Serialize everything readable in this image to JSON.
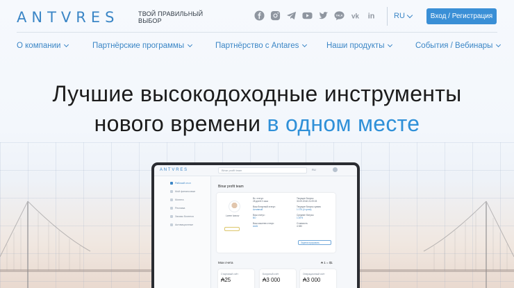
{
  "header": {
    "logo": "ANTVRES",
    "tagline_line1": "ТВОЙ ПРАВИЛЬНЫЙ",
    "tagline_line2": "ВЫБОР",
    "language": "RU",
    "login_button": "Вход / Регистрация",
    "socials": [
      "facebook-icon",
      "instagram-icon",
      "telegram-icon",
      "youtube-icon",
      "twitter-icon",
      "talk-icon",
      "vk-icon",
      "linkedin-icon"
    ],
    "talk_label": "TALK",
    "vk_label": "vk",
    "linkedin_label": "in"
  },
  "nav": {
    "items": [
      {
        "label": "О компании"
      },
      {
        "label": "Партнёрские программы"
      },
      {
        "label": "Партнёрство с Antares"
      },
      {
        "label": "Наши продукты"
      },
      {
        "label": "События / Вебинары"
      }
    ]
  },
  "hero": {
    "line1": "Лучшие высокодоходные инструменты",
    "line2_plain": "нового времени ",
    "line2_accent": "в одном месте"
  },
  "screen": {
    "logo": "ANTVRES",
    "search": "Binar profit team",
    "lang": "RU",
    "sidebar": [
      "Рабочий стол",
      "Мой финансовые",
      "Монета",
      "Реклама",
      "Заказы Бизнеса",
      "Активационные"
    ],
    "title": "Binar profit team",
    "card_name": "Lorem Ivanov",
    "card_col2": [
      "Вс. статус:",
      "28 дней 3 часа",
      "Ваш бонусный статус:",
      "Активный",
      "Ваш статус:",
      "ВО",
      "Ваш кошелек статус:",
      "AAAI"
    ],
    "card_col3": [
      "Текущие бонусы",
      "30.09.2018 21:09:03",
      "Текущие бонусы сумма",
      "1 075 (4 сутки)",
      "Средние бонусы",
      "1.00%",
      "Стоимость",
      "4 080"
    ],
    "card_button": "Зарегистрировать",
    "subtitle": "Мои счета",
    "rate": "₳ 1 = $1",
    "accounts": [
      {
        "label": "Стартовый счёт",
        "value": "₳25"
      },
      {
        "label": "Бонусный счёт",
        "value": "₳3 000"
      },
      {
        "label": "Операционный счёт",
        "value": "₳3 000"
      }
    ]
  },
  "colors": {
    "accent": "#3a8fd6",
    "logo": "#3b86c6",
    "icons": "#8f96a0"
  }
}
